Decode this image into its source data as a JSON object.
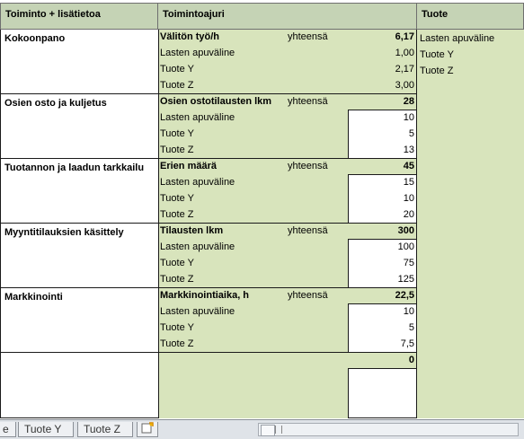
{
  "headers": {
    "activity": "Toiminto + lisätietoa",
    "driver": "Toimintoajuri",
    "product": "Tuote"
  },
  "activities": [
    {
      "name": "Kokoonpano",
      "driver": "Välitön työ/h",
      "total_label": "yhteensä",
      "total": "6,17",
      "items": [
        {
          "label": "Lasten apuväline",
          "value": "1,00"
        },
        {
          "label": "Tuote Y",
          "value": "2,17"
        },
        {
          "label": "Tuote Z",
          "value": "3,00"
        }
      ]
    },
    {
      "name": "Osien osto ja kuljetus",
      "driver": "Osien ostotilausten lkm",
      "total_label": "yhteensä",
      "total": "28",
      "items": [
        {
          "label": "Lasten apuväline",
          "value": "10"
        },
        {
          "label": "Tuote Y",
          "value": "5"
        },
        {
          "label": "Tuote Z",
          "value": "13"
        }
      ]
    },
    {
      "name": "Tuotannon ja laadun tarkkailu",
      "driver": "Erien määrä",
      "total_label": "yhteensä",
      "total": "45",
      "items": [
        {
          "label": "Lasten apuväline",
          "value": "15"
        },
        {
          "label": "Tuote Y",
          "value": "10"
        },
        {
          "label": "Tuote Z",
          "value": "20"
        }
      ]
    },
    {
      "name": "Myyntitilauksien käsittely",
      "driver": "Tilausten lkm",
      "total_label": "yhteensä",
      "total": "300",
      "items": [
        {
          "label": "Lasten apuväline",
          "value": "100"
        },
        {
          "label": "Tuote Y",
          "value": "75"
        },
        {
          "label": "Tuote Z",
          "value": "125"
        }
      ]
    },
    {
      "name": "Markkinointi",
      "driver": "Markkinointiaika, h",
      "total_label": "yhteensä",
      "total": "22,5",
      "items": [
        {
          "label": "Lasten apuväline",
          "value": "10"
        },
        {
          "label": "Tuote Y",
          "value": "5"
        },
        {
          "label": "Tuote Z",
          "value": "7,5"
        }
      ]
    }
  ],
  "blank_total": "0",
  "products": [
    "Lasten apuväline",
    "Tuote Y",
    "Tuote Z"
  ],
  "tabs": [
    "e",
    "Tuote Y",
    "Tuote Z"
  ]
}
